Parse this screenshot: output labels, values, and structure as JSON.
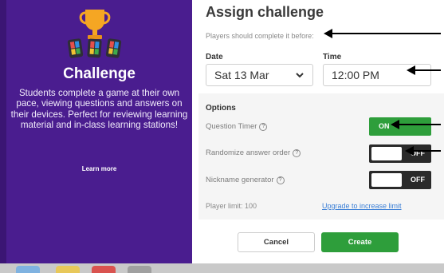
{
  "sidebar": {
    "title": "Challenge",
    "description": "Students complete a game at their own pace, viewing questions and answers on their devices. Perfect for reviewing learning material and in-class learning stations!",
    "learn_more": "Learn more",
    "trophy_icon": "trophy-icon",
    "devices_icon": "phones-icon",
    "background_color": "#4a1d8f"
  },
  "header": {
    "title": "Assign challenge",
    "subtitle": "Players should complete it before:"
  },
  "schedule": {
    "date_label": "Date",
    "date_value": "Sat 13 Mar",
    "time_label": "Time",
    "time_value": "12:00 PM"
  },
  "options": {
    "title": "Options",
    "items": [
      {
        "label": "Question Timer",
        "state": "ON"
      },
      {
        "label": "Randomize answer order",
        "state": "OFF"
      },
      {
        "label": "Nickname generator",
        "state": "OFF"
      }
    ],
    "player_limit": "Player limit: 100",
    "upgrade_link": "Upgrade to increase limit"
  },
  "buttons": {
    "cancel": "Cancel",
    "create": "Create"
  },
  "colors": {
    "accent_green": "#2e9e3b",
    "link_blue": "#3b7fd6",
    "toggle_off": "#2a2a2a"
  }
}
